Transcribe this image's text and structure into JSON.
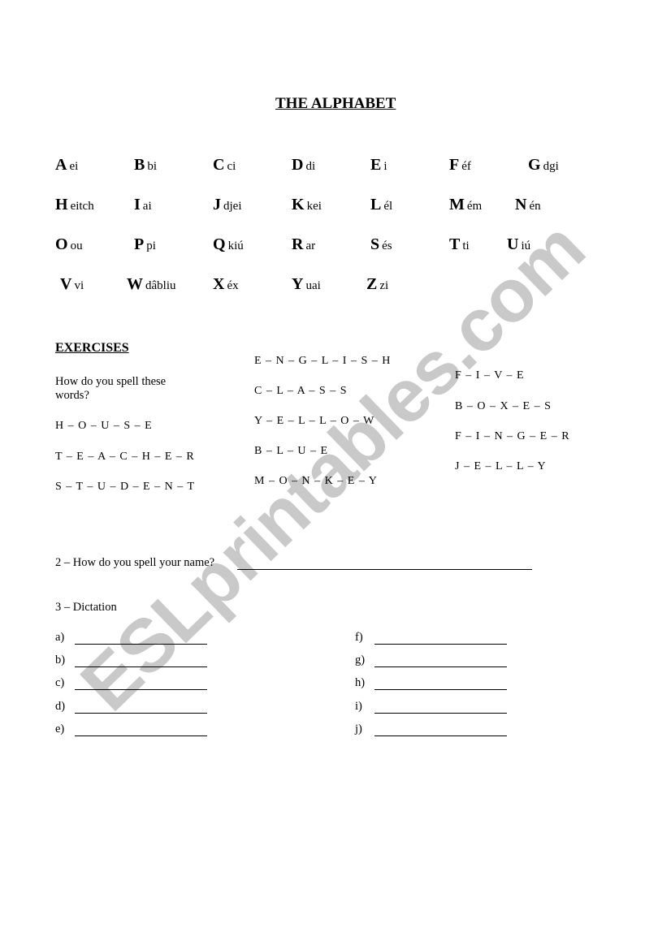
{
  "watermark": "ESLprintables.com",
  "title": "THE ALPHABET",
  "alphabet": [
    {
      "letter": "A",
      "sound": "ei"
    },
    {
      "letter": "B",
      "sound": "bi"
    },
    {
      "letter": "C",
      "sound": "ci"
    },
    {
      "letter": "D",
      "sound": "di"
    },
    {
      "letter": "E",
      "sound": "i"
    },
    {
      "letter": "F",
      "sound": "éf"
    },
    {
      "letter": "G",
      "sound": "dgi"
    },
    {
      "letter": "H",
      "sound": "eitch"
    },
    {
      "letter": "I",
      "sound": "ai"
    },
    {
      "letter": "J",
      "sound": "djei"
    },
    {
      "letter": "K",
      "sound": "kei"
    },
    {
      "letter": "L",
      "sound": "él"
    },
    {
      "letter": "M",
      "sound": "ém"
    },
    {
      "letter": "N",
      "sound": "én"
    },
    {
      "letter": "O",
      "sound": "ou"
    },
    {
      "letter": "P",
      "sound": "pi"
    },
    {
      "letter": "Q",
      "sound": "kiú"
    },
    {
      "letter": "R",
      "sound": "ar"
    },
    {
      "letter": "S",
      "sound": "és"
    },
    {
      "letter": "T",
      "sound": "ti"
    },
    {
      "letter": "U",
      "sound": "iú"
    },
    {
      "letter": "V",
      "sound": "vi"
    },
    {
      "letter": "W",
      "sound": "dâbliu"
    },
    {
      "letter": "X",
      "sound": "éx"
    },
    {
      "letter": "Y",
      "sound": "uai"
    },
    {
      "letter": "Z",
      "sound": "zi"
    }
  ],
  "exercises": {
    "heading": "EXERCISES",
    "instruction": "How do you spell these words?",
    "column1": [
      "H – O – U – S – E",
      "T – E – A – C – H – E – R",
      "S – T – U – D – E – N – T"
    ],
    "column2": [
      "E – N – G – L – I – S – H",
      "C – L – A – S – S",
      "Y – E – L – L – O – W",
      "B – L – U – E",
      "M – O – N – K – E – Y"
    ],
    "column3": [
      "F – I – V – E",
      "B – O – X – E – S",
      "F – I – N – G – E – R",
      "J – E – L – L – Y"
    ]
  },
  "question2": {
    "label": "2 – How do you spell your name?",
    "answer": ""
  },
  "question3": {
    "label": "3 – Dictation",
    "items": [
      {
        "label": "a)",
        "answer": ""
      },
      {
        "label": "b)",
        "answer": ""
      },
      {
        "label": "c)",
        "answer": ""
      },
      {
        "label": "d)",
        "answer": ""
      },
      {
        "label": "e)",
        "answer": ""
      },
      {
        "label": "f)",
        "answer": ""
      },
      {
        "label": "g)",
        "answer": ""
      },
      {
        "label": "h)",
        "answer": ""
      },
      {
        "label": "i)",
        "answer": ""
      },
      {
        "label": "j)",
        "answer": ""
      }
    ]
  }
}
